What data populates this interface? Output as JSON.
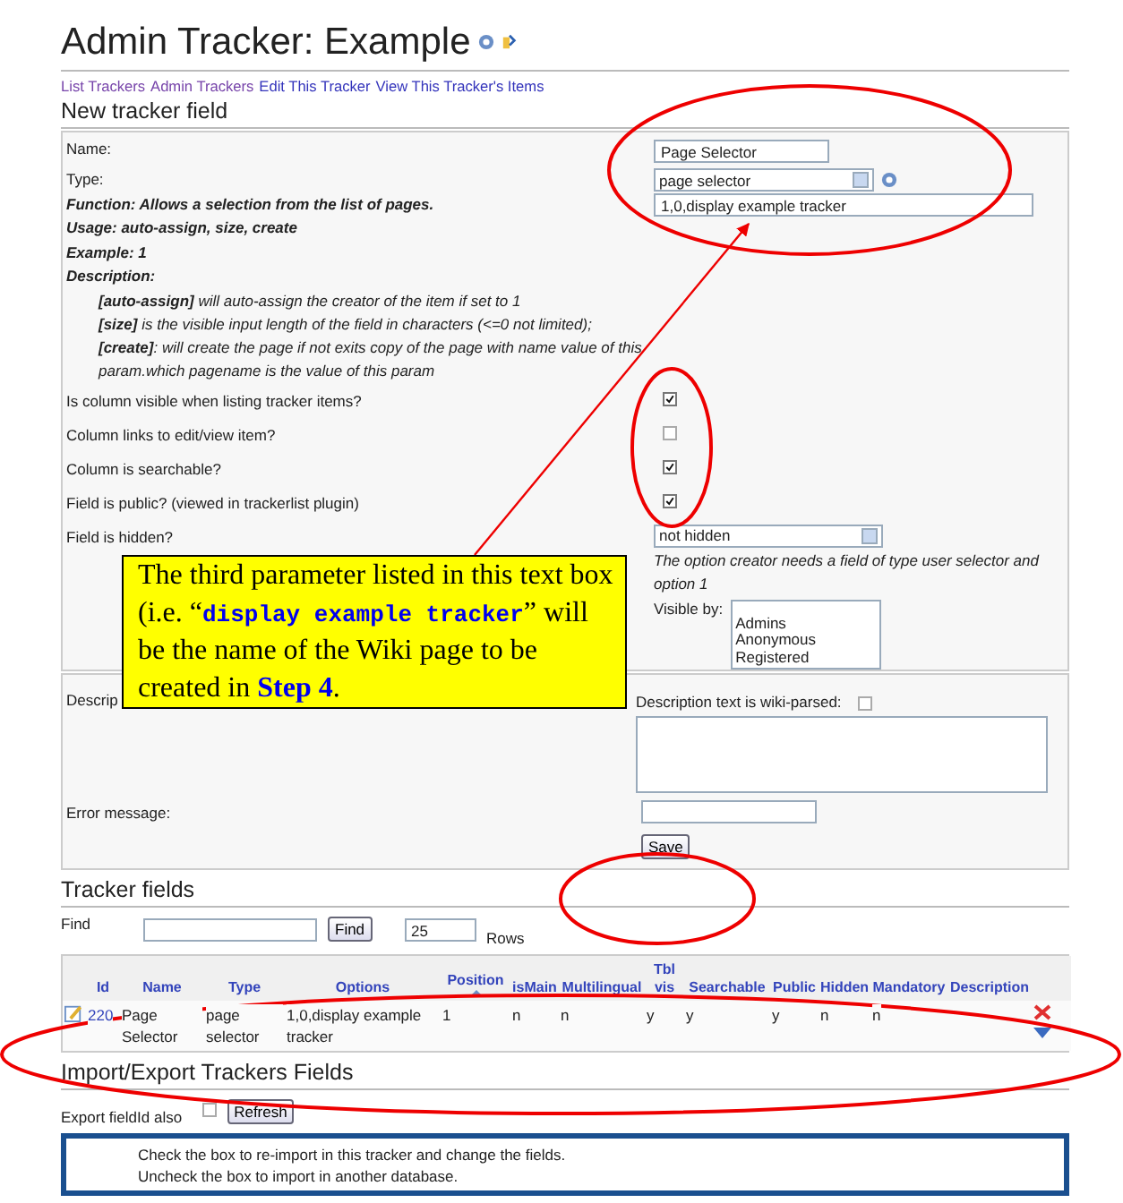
{
  "title": "Admin Tracker: Example",
  "nav_links": [
    {
      "label": "List Trackers",
      "visited": true
    },
    {
      "label": "Admin Trackers",
      "visited": true
    },
    {
      "label": "Edit This Tracker",
      "visited": false
    },
    {
      "label": "View This Tracker's Items",
      "visited": false
    }
  ],
  "new_field": {
    "heading": "New tracker field",
    "name": {
      "label": "Name:",
      "value": "Page Selector"
    },
    "type": {
      "label": "Type:",
      "value": "page selector"
    },
    "options_value": "1,0,display example tracker",
    "help": {
      "function": "Function: Allows a selection from the list of pages.",
      "usage": "Usage: auto-assign, size, create",
      "example": "Example: 1",
      "description_label": "Description:",
      "params": [
        "**[auto-assign]** will auto-assign the creator of the item if set to 1",
        "**[size]** is the visible input length of the field in characters (<=0 not limited);",
        "**[create]**: will create the page if not exits copy of the page with name value of this param.which pagename is the value of this param"
      ]
    },
    "toggles": [
      {
        "label": "Is column visible when listing tracker items?",
        "checked": true
      },
      {
        "label": "Column links to edit/view item?",
        "checked": false
      },
      {
        "label": "Column is searchable?",
        "checked": true
      },
      {
        "label": "Field is public? (viewed in trackerlist plugin)",
        "checked": true
      }
    ],
    "hidden": {
      "label": "Field is hidden?",
      "value": "not hidden",
      "note": "The option creator needs a field of type user selector and option 1",
      "visible_by_label": "Visible by:",
      "visible_by_options": [
        "Admins",
        "Anonymous",
        "Registered"
      ]
    },
    "description": {
      "label": "Descrip",
      "wiki_parsed_label": "Description text is wiki-parsed:",
      "wiki_parsed_checked": false
    },
    "error_message": {
      "label": "Error message:"
    },
    "save_button": "Save"
  },
  "tracker_fields": {
    "heading": "Tracker fields",
    "find_label": "Find",
    "find_button": "Find",
    "rows_value": "25",
    "rows_label": "Rows",
    "columns": [
      "Id",
      "Name",
      "Type",
      "Options",
      "Position",
      "isMain",
      "Multilingual",
      "Tbl vis",
      "Searchable",
      "Public",
      "Hidden",
      "Mandatory",
      "Description"
    ],
    "rows": [
      {
        "cells": [
          "220",
          "Page Selector",
          "page selector",
          "1,0,display example tracker",
          "1",
          "n",
          "n",
          "y",
          "y",
          "y",
          "n",
          "n"
        ]
      }
    ]
  },
  "import_export": {
    "heading": "Import/Export Trackers Fields",
    "export_label": "Export fieldId also",
    "export_checked": false,
    "refresh_button": "Refresh",
    "notes": [
      "Check the box to re-import in this tracker and change the fields.",
      "Uncheck the box to import in another database."
    ]
  },
  "callout": {
    "text": "The third parameter listed in this text box (i.e. “**display example tracker**” will be the name of the Wiki page to be created in **Step 4**."
  }
}
